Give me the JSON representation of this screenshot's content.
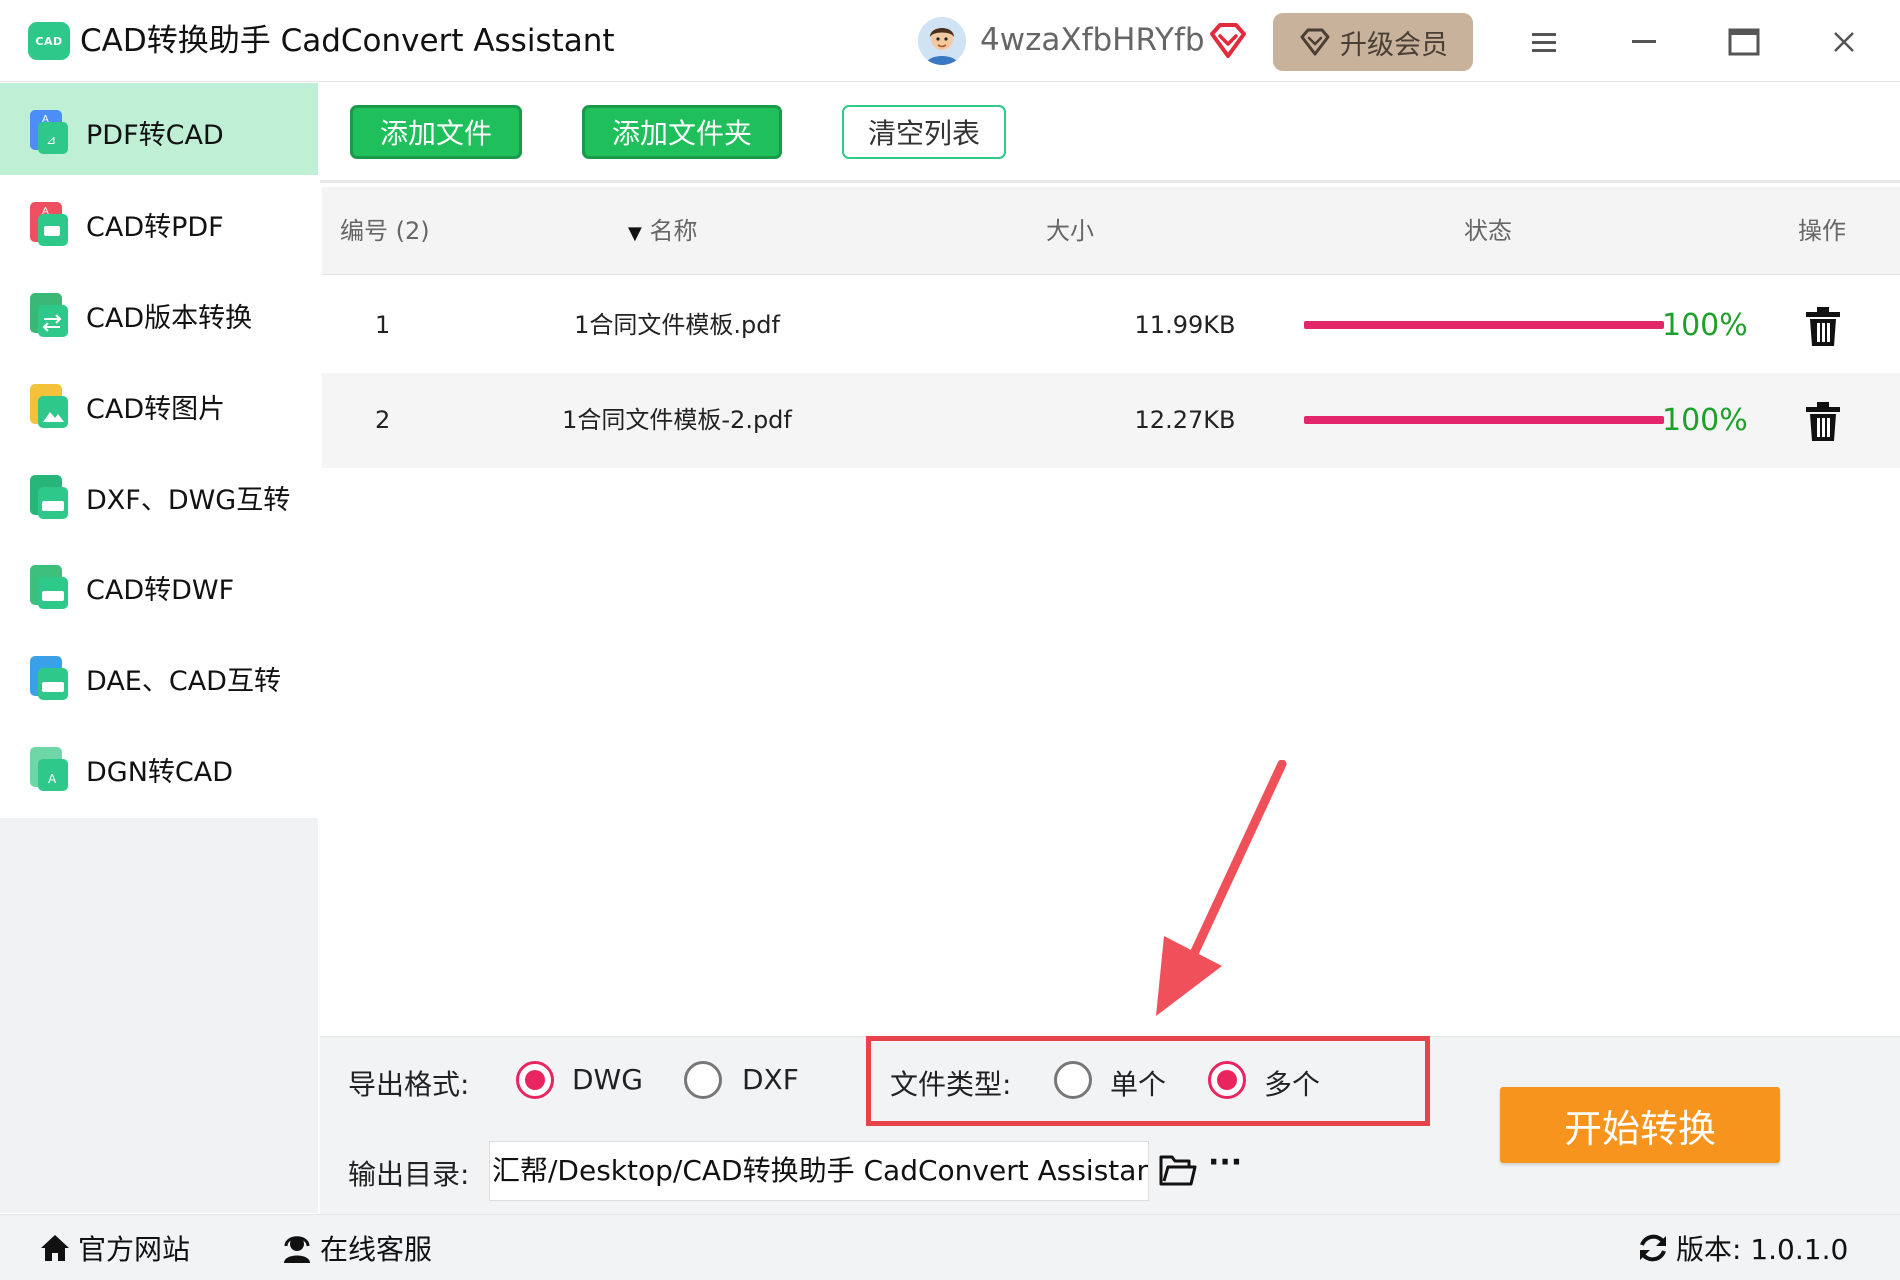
{
  "app": {
    "logo_text": "CAD",
    "title": "CAD转换助手 CadConvert Assistant",
    "username": "4wzaXfbHRYfb",
    "upgrade_label": "升级会员"
  },
  "sidebar": {
    "items": [
      {
        "label": "PDF转CAD",
        "icon": "pdf-to-cad-icon",
        "active": true
      },
      {
        "label": "CAD转PDF",
        "icon": "cad-to-pdf-icon"
      },
      {
        "label": "CAD版本转换",
        "icon": "cad-version-icon"
      },
      {
        "label": "CAD转图片",
        "icon": "cad-to-image-icon"
      },
      {
        "label": "DXF、DWG互转",
        "icon": "dxf-dwg-icon"
      },
      {
        "label": "CAD转DWF",
        "icon": "cad-to-dwf-icon"
      },
      {
        "label": "DAE、CAD互转",
        "icon": "dae-cad-icon"
      },
      {
        "label": "DGN转CAD",
        "icon": "dgn-to-cad-icon"
      }
    ]
  },
  "toolbar": {
    "add_file": "添加文件",
    "add_folder": "添加文件夹",
    "clear_list": "清空列表"
  },
  "table": {
    "headers": {
      "index": "编号 (2)",
      "name": "名称",
      "size": "大小",
      "status": "状态",
      "action": "操作"
    },
    "rows": [
      {
        "index": "1",
        "name": "1合同文件模板.pdf",
        "size": "11.99KB",
        "progress": 100,
        "progress_text": "100%"
      },
      {
        "index": "2",
        "name": "1合同文件模板-2.pdf",
        "size": "12.27KB",
        "progress": 100,
        "progress_text": "100%"
      }
    ]
  },
  "options": {
    "export_format_label": "导出格式:",
    "formats": [
      {
        "label": "DWG",
        "selected": true
      },
      {
        "label": "DXF",
        "selected": false
      }
    ],
    "file_type_label": "文件类型:",
    "file_types": [
      {
        "label": "单个",
        "selected": false
      },
      {
        "label": "多个",
        "selected": true
      }
    ],
    "output_dir_label": "输出目录:",
    "output_dir": "汇帮/Desktop/CAD转换助手 CadConvert Assistant",
    "more": "···",
    "start_button": "开始转换"
  },
  "footer": {
    "website": "官方网站",
    "support": "在线客服",
    "version": "版本: 1.0.1.0"
  },
  "colors": {
    "accent_green": "#1fbf5b",
    "active_sidebar": "#bff0d6",
    "progress": "#e3266a",
    "percent_text": "#1da12b",
    "radio_selected": "#e8255f",
    "start_button": "#f7941d",
    "highlight": "#e8434a"
  }
}
